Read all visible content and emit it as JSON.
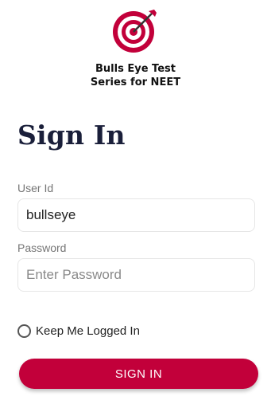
{
  "brand": {
    "line1": "Bulls Eye Test",
    "line2": "Series for NEET",
    "accent_color": "#c2003a"
  },
  "signin": {
    "title": "Sign In",
    "userid_label": "User Id",
    "userid_value": "bullseye",
    "password_label": "Password",
    "password_placeholder": "Enter Password",
    "keep_logged_in_label": "Keep Me Logged In",
    "keep_logged_in_checked": false,
    "button_label": "SIGN IN"
  }
}
